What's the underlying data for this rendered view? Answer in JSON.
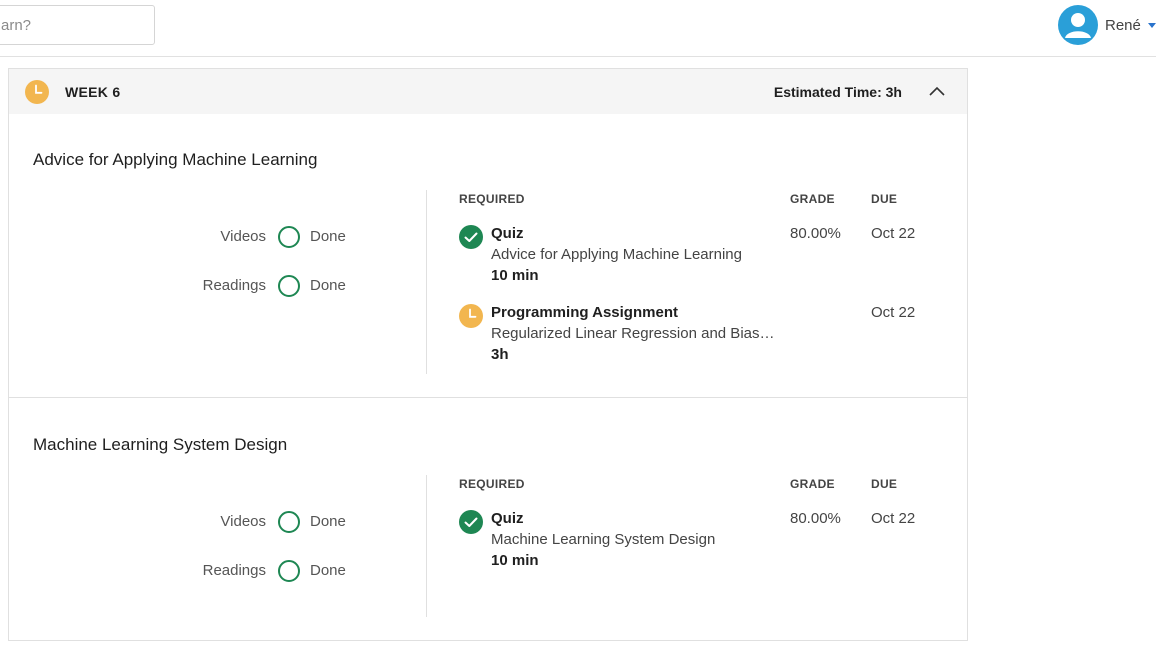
{
  "search": {
    "placeholder": "What do you want to learn?",
    "visible_placeholder": "arn?"
  },
  "user": {
    "name": "René"
  },
  "week": {
    "title": "WEEK 6",
    "estimated_time": "Estimated Time: 3h"
  },
  "columns": {
    "required": "REQUIRED",
    "grade": "GRADE",
    "due": "DUE"
  },
  "lessons": [
    {
      "title": "Advice for Applying Machine Learning",
      "stats": [
        {
          "label": "Videos",
          "value": "Done"
        },
        {
          "label": "Readings",
          "value": "Done"
        }
      ],
      "items": [
        {
          "icon": "check-circle-icon",
          "type": "Quiz",
          "name": "Advice for Applying Machine Learning",
          "duration": "10 min",
          "grade": "80.00%",
          "due": "Oct 22"
        },
        {
          "icon": "clock-icon",
          "type": "Programming Assignment",
          "name": "Regularized Linear Regression and Bias…",
          "duration": "3h",
          "grade": "",
          "due": "Oct 22"
        }
      ]
    },
    {
      "title": "Machine Learning System Design",
      "stats": [
        {
          "label": "Videos",
          "value": "Done"
        },
        {
          "label": "Readings",
          "value": "Done"
        }
      ],
      "items": [
        {
          "icon": "check-circle-icon",
          "type": "Quiz",
          "name": "Machine Learning System Design",
          "duration": "10 min",
          "grade": "80.00%",
          "due": "Oct 22"
        }
      ]
    }
  ],
  "colors": {
    "accent_green": "#1e8753",
    "clock_orange": "#f2b64f",
    "avatar_blue": "#2a9fd8",
    "link_blue": "#2a73cc"
  }
}
